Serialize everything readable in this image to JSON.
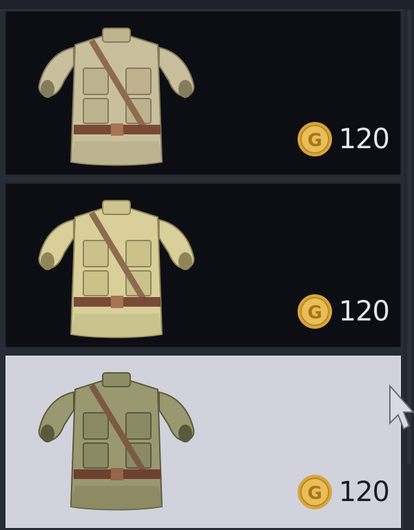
{
  "shop": {
    "items": [
      {
        "name": "Tunic (beige)",
        "price": "120",
        "currency_icon": "gold-coin-icon",
        "selected": false,
        "fabric_color": "#c9bf9c",
        "shadow_color": "#857c5e"
      },
      {
        "name": "Tunic (light khaki)",
        "price": "120",
        "currency_icon": "gold-coin-icon",
        "selected": false,
        "fabric_color": "#d8cf9a",
        "shadow_color": "#8f8658"
      },
      {
        "name": "Tunic (olive)",
        "price": "120",
        "currency_icon": "gold-coin-icon",
        "selected": true,
        "fabric_color": "#9a9870",
        "shadow_color": "#5a5a3c"
      }
    ]
  },
  "colors": {
    "card_bg": "#0d0e14",
    "card_selected_bg": "#d2d2dd",
    "coin_gold": "#d8a63a",
    "belt": "#7a4a36"
  }
}
